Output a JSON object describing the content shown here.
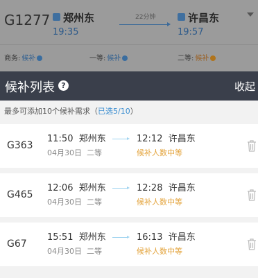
{
  "background_card": {
    "train_no": "G1277",
    "from_station": "郑州东",
    "to_station": "许昌东",
    "duration": "22分钟",
    "depart_time": "19:35",
    "arrive_time": "19:57",
    "seats": [
      {
        "label": "商务:",
        "status": "候补",
        "color": "blue"
      },
      {
        "label": "一等:",
        "status": "候补",
        "color": "blue"
      },
      {
        "label": "二等:",
        "status": "候补",
        "color": "orange"
      }
    ]
  },
  "sheet": {
    "title": "候补列表",
    "collapse_label": "收起",
    "hint_prefix": "最多可添加10个候补需求（",
    "hint_selected": "已选5/10",
    "hint_suffix": "）"
  },
  "trains": [
    {
      "train_no": "G363",
      "depart_time": "11:50",
      "from": "郑州东",
      "arrive_time": "12:12",
      "to": "许昌东",
      "date": "04月30日",
      "seat": "二等",
      "status": "候补人数中等"
    },
    {
      "train_no": "G465",
      "depart_time": "12:06",
      "from": "郑州东",
      "arrive_time": "12:28",
      "to": "许昌东",
      "date": "04月30日",
      "seat": "二等",
      "status": "候补人数中等"
    },
    {
      "train_no": "G67",
      "depart_time": "15:51",
      "from": "郑州东",
      "arrive_time": "16:13",
      "to": "许昌东",
      "date": "04月30日",
      "seat": "二等",
      "status": "候补人数中等"
    }
  ],
  "colors": {
    "header_bg": "#3a3f4b",
    "accent_blue": "#3d8fd1",
    "status_orange": "#e3a33b",
    "overlay_gray": "#9b9b9b"
  }
}
